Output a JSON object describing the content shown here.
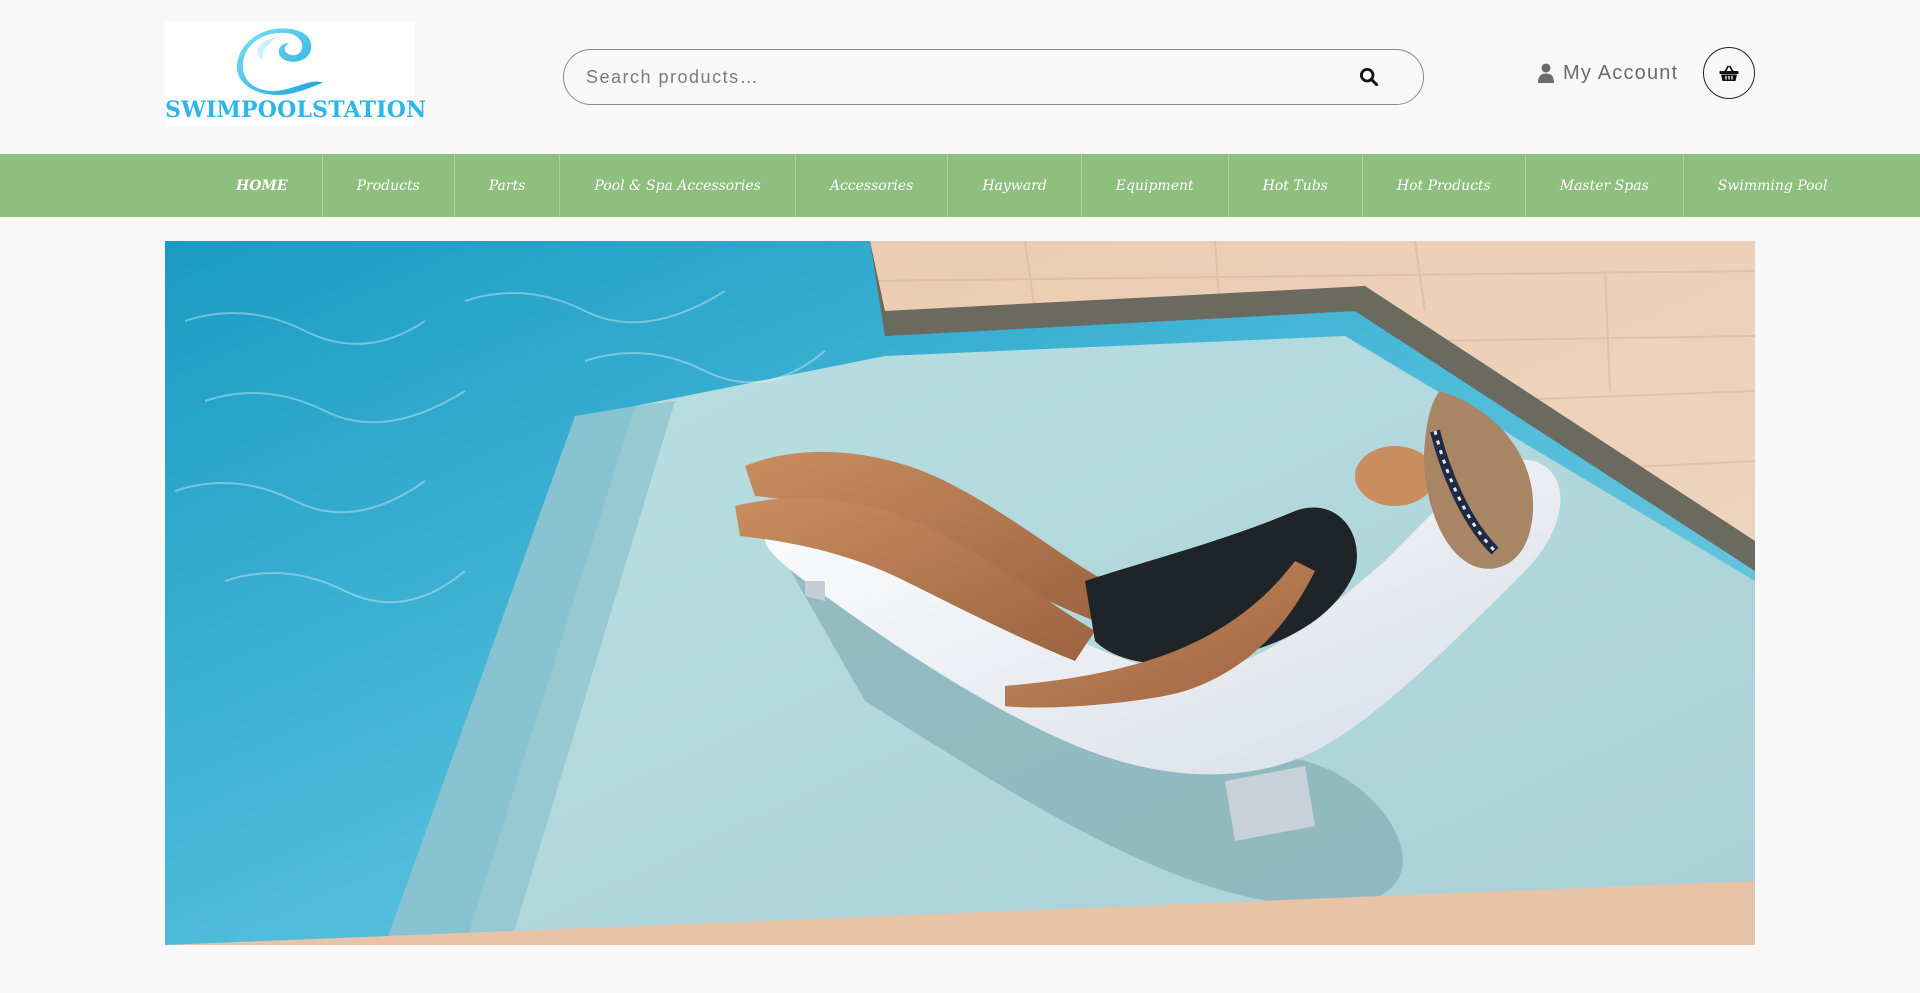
{
  "brand": {
    "name": "SWIMPOOLSTATION",
    "color": "#2eb6e8"
  },
  "search": {
    "placeholder": "Search products…",
    "value": "",
    "icon": "search-icon"
  },
  "account": {
    "label": "My Account",
    "icon": "user-icon"
  },
  "cart": {
    "icon": "basket-icon"
  },
  "nav": {
    "background": "#8ebf7e",
    "items": [
      {
        "label": "HOME",
        "active": true
      },
      {
        "label": "Products"
      },
      {
        "label": "Parts"
      },
      {
        "label": "Pool & Spa Accessories"
      },
      {
        "label": "Accessories"
      },
      {
        "label": "Hayward"
      },
      {
        "label": "Equipment"
      },
      {
        "label": "Hot Tubs"
      },
      {
        "label": "Hot Products"
      },
      {
        "label": "Master Spas"
      },
      {
        "label": "Swimming Pool"
      }
    ]
  },
  "hero": {
    "image": "woman-lounging-on-pool-chaise"
  }
}
